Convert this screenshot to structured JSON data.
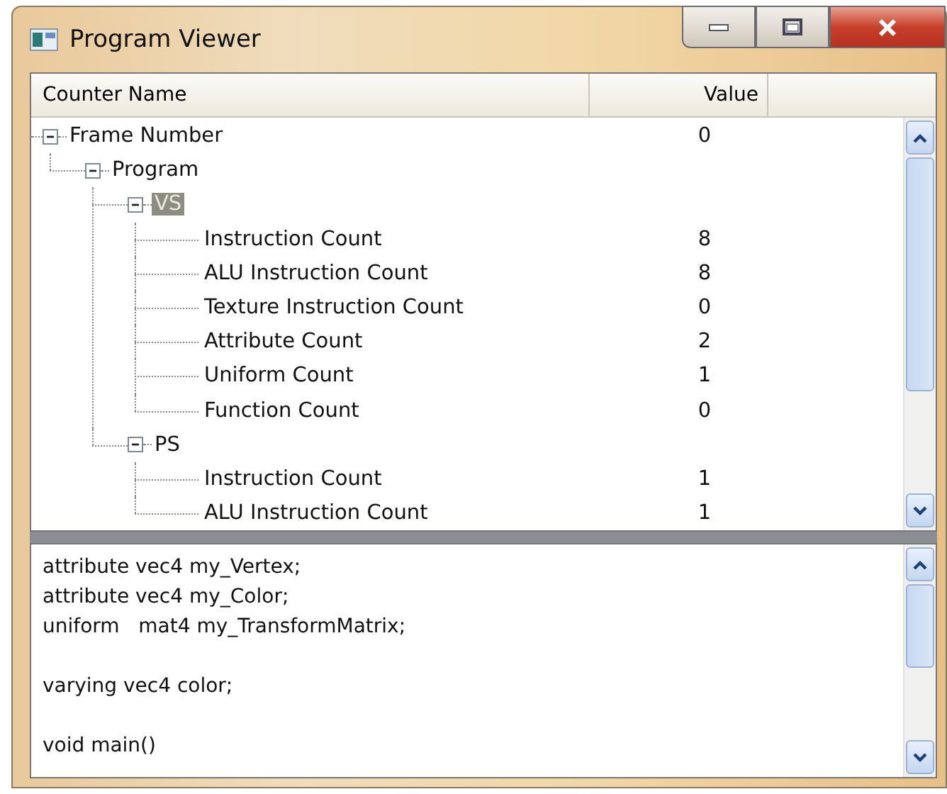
{
  "window": {
    "title": "Program Viewer"
  },
  "tree": {
    "columns": [
      "Counter Name",
      "Value"
    ],
    "rows": [
      {
        "label": "Frame Number",
        "value": "0",
        "expanded": true,
        "selected": false,
        "children": [
          {
            "label": "Program",
            "expanded": true,
            "selected": false,
            "children": [
              {
                "label": "VS",
                "expanded": true,
                "selected": true,
                "children": [
                  {
                    "label": "Instruction Count",
                    "value": "8",
                    "selected": false
                  },
                  {
                    "label": "ALU Instruction Count",
                    "value": "8",
                    "selected": false
                  },
                  {
                    "label": "Texture Instruction Count",
                    "value": "0",
                    "selected": false
                  },
                  {
                    "label": "Attribute Count",
                    "value": "2",
                    "selected": false
                  },
                  {
                    "label": "Uniform Count",
                    "value": "1",
                    "selected": false
                  },
                  {
                    "label": "Function Count",
                    "value": "0",
                    "selected": false
                  }
                ]
              },
              {
                "label": "PS",
                "expanded": true,
                "selected": false,
                "children": [
                  {
                    "label": "Instruction Count",
                    "value": "1",
                    "selected": false
                  },
                  {
                    "label": "ALU Instruction Count",
                    "value": "1",
                    "selected": false
                  }
                ]
              }
            ]
          }
        ]
      }
    ]
  },
  "source": {
    "text": "attribute vec4 my_Vertex;\nattribute vec4 my_Color;\nuniform   mat4 my_TransformMatrix;\n\nvarying vec4 color;\n\nvoid main()"
  }
}
